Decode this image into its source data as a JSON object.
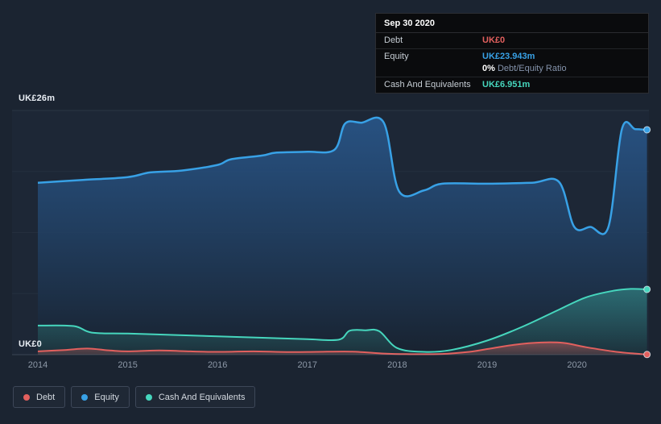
{
  "chart_data": {
    "type": "area",
    "grid": true,
    "legend_position": "bottom-left",
    "x_axis": {
      "min": 2014,
      "ticks": [
        2014,
        2015,
        2016,
        2017,
        2018,
        2019,
        2020
      ]
    },
    "y_axis": {
      "min": 0,
      "max": 26,
      "top_label": "UK£26m",
      "bottom_label": "UK£0",
      "unit_prefix": "UK£",
      "unit_suffix": "m"
    },
    "series": [
      {
        "name": "Debt",
        "color": "#e2605e",
        "x": [
          2014.0,
          2014.3,
          2014.55,
          2014.8,
          2015.0,
          2015.35,
          2015.7,
          2016.0,
          2016.4,
          2016.8,
          2017.1,
          2017.5,
          2017.85,
          2018.1,
          2018.5,
          2018.8,
          2019.0,
          2019.3,
          2019.6,
          2019.85,
          2020.1,
          2020.4,
          2020.6,
          2020.78
        ],
        "values": [
          0.35,
          0.5,
          0.65,
          0.45,
          0.35,
          0.45,
          0.35,
          0.3,
          0.35,
          0.28,
          0.3,
          0.33,
          0.12,
          0.06,
          0.08,
          0.3,
          0.6,
          1.05,
          1.3,
          1.25,
          0.8,
          0.35,
          0.15,
          0.02
        ]
      },
      {
        "name": "Equity",
        "color": "#38a1e6",
        "x": [
          2014.0,
          2014.5,
          2015.0,
          2015.25,
          2015.6,
          2016.0,
          2016.15,
          2016.5,
          2016.65,
          2017.0,
          2017.3,
          2017.42,
          2017.6,
          2017.85,
          2018.02,
          2018.3,
          2018.5,
          2019.0,
          2019.5,
          2019.8,
          2019.97,
          2020.15,
          2020.35,
          2020.5,
          2020.65,
          2020.78
        ],
        "values": [
          18.3,
          18.6,
          18.9,
          19.4,
          19.6,
          20.2,
          20.8,
          21.2,
          21.5,
          21.6,
          21.8,
          24.6,
          24.7,
          24.7,
          17.4,
          17.5,
          18.2,
          18.2,
          18.3,
          18.4,
          13.6,
          13.6,
          13.6,
          24.0,
          24.0,
          23.943
        ]
      },
      {
        "name": "Cash And Equivalents",
        "color": "#46d6bd",
        "x": [
          2014.0,
          2014.4,
          2014.6,
          2015.0,
          2015.5,
          2016.0,
          2016.5,
          2017.0,
          2017.35,
          2017.47,
          2017.65,
          2017.8,
          2018.0,
          2018.3,
          2018.6,
          2019.0,
          2019.4,
          2019.8,
          2020.1,
          2020.4,
          2020.6,
          2020.78
        ],
        "values": [
          3.1,
          3.05,
          2.35,
          2.25,
          2.1,
          1.95,
          1.8,
          1.65,
          1.6,
          2.55,
          2.6,
          2.5,
          0.7,
          0.3,
          0.5,
          1.5,
          3.0,
          4.8,
          6.1,
          6.8,
          7.0,
          6.951
        ]
      }
    ]
  },
  "tooltip": {
    "date": "Sep 30 2020",
    "debt_label": "Debt",
    "debt_value": "UK£0",
    "equity_label": "Equity",
    "equity_value": "UK£23.943m",
    "ratio_value": "0%",
    "ratio_label": "Debt/Equity Ratio",
    "cash_label": "Cash And Equivalents",
    "cash_value": "UK£6.951m"
  },
  "legend": {
    "items": [
      {
        "label": "Debt"
      },
      {
        "label": "Equity"
      },
      {
        "label": "Cash And Equivalents"
      }
    ]
  }
}
